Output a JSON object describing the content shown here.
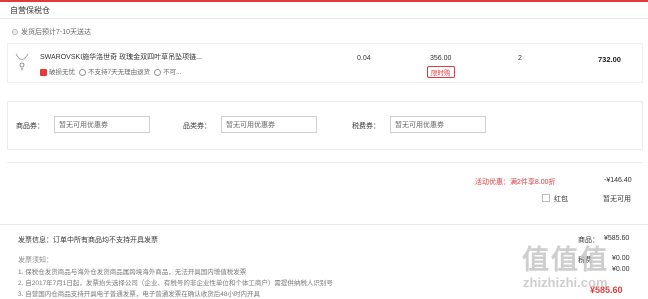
{
  "section": {
    "title": "自营保税仓"
  },
  "shipping": {
    "text": "发货后预计7-10天送达"
  },
  "item": {
    "name": "SWAROVSKI施华洛世奇 玫瑰金双四叶草吊坠项链...",
    "service_badge": "破损无忧",
    "service_2": "不支持7天无理由退货",
    "service_3": "不可...",
    "tax": "0.04",
    "price": "356.00",
    "limit_tag": "限时购",
    "qty": "2",
    "subtotal": "732.00"
  },
  "coupons": [
    {
      "label": "商品券：",
      "placeholder": "暂无可用优惠券"
    },
    {
      "label": "品类券：",
      "placeholder": "暂无可用优惠券"
    },
    {
      "label": "税费券：",
      "placeholder": "暂无可用优惠券"
    }
  ],
  "summary": {
    "promo_label": "活动优惠：满2件享8.00折",
    "promo_amount": "-¥146.40",
    "redpack_label": "红包",
    "redpack_status": "暂无可用"
  },
  "invoice": {
    "info": "发票信息：订单中所有商品均不支持开具发票",
    "notice_title": "发票须知：",
    "notice_lines": [
      "1. 保税仓发货商品与海外仓发货商品属跨境海外商品，无法开具国内增值税发票",
      "2. 自2017年7月1日起，发票抬头选择公司（企业、有税号的非企业性单位和个体工商户）需提供纳税人识别号",
      "3. 自营国内仓商品支持开具电子普通发票，电子普通发票在确认收货后48小时内开具"
    ]
  },
  "totals": {
    "goods_label": "商品：",
    "goods_value": "¥585.60",
    "tax_label": "税费：",
    "tax_value": "¥0.00",
    "freight_value": "¥0.00",
    "grand_total": "¥585.60"
  },
  "watermark": {
    "text": "值值值",
    "url": "zhizhizhi.com"
  },
  "colors": {
    "accent": "#e4393c",
    "border": "#ececec"
  }
}
